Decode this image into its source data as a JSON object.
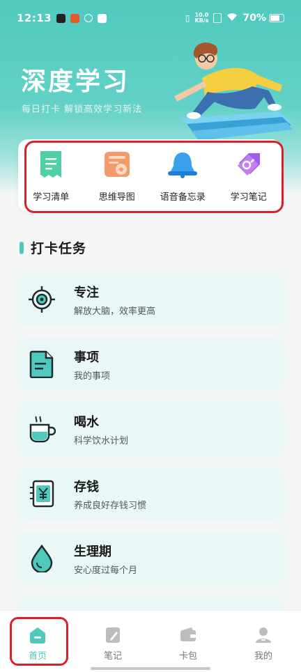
{
  "status_bar": {
    "time": "12:13",
    "net_speed_value": "10.0",
    "net_speed_unit": "KB/s",
    "battery": "70%",
    "icons": [
      "n-app-icon",
      "app-icon",
      "link-icon",
      "message-icon",
      "vibrate-icon",
      "sim-icon",
      "wifi-icon",
      "battery-icon"
    ]
  },
  "hero": {
    "title": "深度学习",
    "subtitle": "每日打卡 解锁高效学习新法"
  },
  "quick_actions": [
    {
      "label": "学习清单",
      "icon": "list-icon",
      "color": "#4fd1a5"
    },
    {
      "label": "思维导图",
      "icon": "mindmap-icon",
      "color": "#f39b6d"
    },
    {
      "label": "语音备忘录",
      "icon": "bell-icon",
      "color": "#3aa0f0"
    },
    {
      "label": "学习笔记",
      "icon": "tag-icon",
      "color": "#a05ce6"
    }
  ],
  "section": {
    "title": "打卡任务"
  },
  "tasks": [
    {
      "title": "专注",
      "subtitle": "解放大脑，效率更高",
      "icon": "target-icon"
    },
    {
      "title": "事项",
      "subtitle": "我的事项",
      "icon": "document-icon"
    },
    {
      "title": "喝水",
      "subtitle": "科学饮水计划",
      "icon": "cup-icon"
    },
    {
      "title": "存钱",
      "subtitle": "养成良好存钱习惯",
      "icon": "yen-icon"
    },
    {
      "title": "生理期",
      "subtitle": "安心度过每个月",
      "icon": "drop-icon"
    }
  ],
  "tab_bar": [
    {
      "label": "首页",
      "icon": "home-icon",
      "active": true
    },
    {
      "label": "笔记",
      "icon": "note-icon",
      "active": false
    },
    {
      "label": "卡包",
      "icon": "wallet-icon",
      "active": false
    },
    {
      "label": "我的",
      "icon": "profile-icon",
      "active": false
    }
  ],
  "colors": {
    "accent": "#4fc9be",
    "highlight": "#d8202a"
  }
}
